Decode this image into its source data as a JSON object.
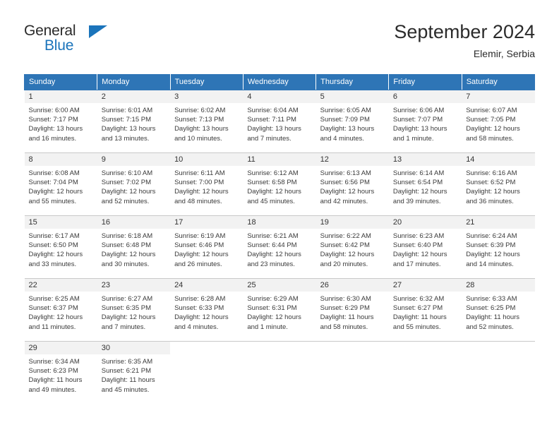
{
  "brand": {
    "name_top": "General",
    "name_bottom": "Blue",
    "triangle_icon": "triangle-icon",
    "accent_color": "#1b74bb"
  },
  "header": {
    "title": "September 2024",
    "subtitle": "Elemir, Serbia"
  },
  "theme": {
    "header_bg": "#2e75b6",
    "header_text": "#ffffff",
    "daynum_bg": "#f2f2f2",
    "cell_bg": "#ffffff",
    "rule_color": "#c9c9c9",
    "text_color": "#3a3a3a"
  },
  "calendar": {
    "weekday_headers": [
      "Sunday",
      "Monday",
      "Tuesday",
      "Wednesday",
      "Thursday",
      "Friday",
      "Saturday"
    ],
    "weeks": [
      [
        {
          "day": "1",
          "sunrise": "Sunrise: 6:00 AM",
          "sunset": "Sunset: 7:17 PM",
          "daylight_1": "Daylight: 13 hours",
          "daylight_2": "and 16 minutes."
        },
        {
          "day": "2",
          "sunrise": "Sunrise: 6:01 AM",
          "sunset": "Sunset: 7:15 PM",
          "daylight_1": "Daylight: 13 hours",
          "daylight_2": "and 13 minutes."
        },
        {
          "day": "3",
          "sunrise": "Sunrise: 6:02 AM",
          "sunset": "Sunset: 7:13 PM",
          "daylight_1": "Daylight: 13 hours",
          "daylight_2": "and 10 minutes."
        },
        {
          "day": "4",
          "sunrise": "Sunrise: 6:04 AM",
          "sunset": "Sunset: 7:11 PM",
          "daylight_1": "Daylight: 13 hours",
          "daylight_2": "and 7 minutes."
        },
        {
          "day": "5",
          "sunrise": "Sunrise: 6:05 AM",
          "sunset": "Sunset: 7:09 PM",
          "daylight_1": "Daylight: 13 hours",
          "daylight_2": "and 4 minutes."
        },
        {
          "day": "6",
          "sunrise": "Sunrise: 6:06 AM",
          "sunset": "Sunset: 7:07 PM",
          "daylight_1": "Daylight: 13 hours",
          "daylight_2": "and 1 minute."
        },
        {
          "day": "7",
          "sunrise": "Sunrise: 6:07 AM",
          "sunset": "Sunset: 7:05 PM",
          "daylight_1": "Daylight: 12 hours",
          "daylight_2": "and 58 minutes."
        }
      ],
      [
        {
          "day": "8",
          "sunrise": "Sunrise: 6:08 AM",
          "sunset": "Sunset: 7:04 PM",
          "daylight_1": "Daylight: 12 hours",
          "daylight_2": "and 55 minutes."
        },
        {
          "day": "9",
          "sunrise": "Sunrise: 6:10 AM",
          "sunset": "Sunset: 7:02 PM",
          "daylight_1": "Daylight: 12 hours",
          "daylight_2": "and 52 minutes."
        },
        {
          "day": "10",
          "sunrise": "Sunrise: 6:11 AM",
          "sunset": "Sunset: 7:00 PM",
          "daylight_1": "Daylight: 12 hours",
          "daylight_2": "and 48 minutes."
        },
        {
          "day": "11",
          "sunrise": "Sunrise: 6:12 AM",
          "sunset": "Sunset: 6:58 PM",
          "daylight_1": "Daylight: 12 hours",
          "daylight_2": "and 45 minutes."
        },
        {
          "day": "12",
          "sunrise": "Sunrise: 6:13 AM",
          "sunset": "Sunset: 6:56 PM",
          "daylight_1": "Daylight: 12 hours",
          "daylight_2": "and 42 minutes."
        },
        {
          "day": "13",
          "sunrise": "Sunrise: 6:14 AM",
          "sunset": "Sunset: 6:54 PM",
          "daylight_1": "Daylight: 12 hours",
          "daylight_2": "and 39 minutes."
        },
        {
          "day": "14",
          "sunrise": "Sunrise: 6:16 AM",
          "sunset": "Sunset: 6:52 PM",
          "daylight_1": "Daylight: 12 hours",
          "daylight_2": "and 36 minutes."
        }
      ],
      [
        {
          "day": "15",
          "sunrise": "Sunrise: 6:17 AM",
          "sunset": "Sunset: 6:50 PM",
          "daylight_1": "Daylight: 12 hours",
          "daylight_2": "and 33 minutes."
        },
        {
          "day": "16",
          "sunrise": "Sunrise: 6:18 AM",
          "sunset": "Sunset: 6:48 PM",
          "daylight_1": "Daylight: 12 hours",
          "daylight_2": "and 30 minutes."
        },
        {
          "day": "17",
          "sunrise": "Sunrise: 6:19 AM",
          "sunset": "Sunset: 6:46 PM",
          "daylight_1": "Daylight: 12 hours",
          "daylight_2": "and 26 minutes."
        },
        {
          "day": "18",
          "sunrise": "Sunrise: 6:21 AM",
          "sunset": "Sunset: 6:44 PM",
          "daylight_1": "Daylight: 12 hours",
          "daylight_2": "and 23 minutes."
        },
        {
          "day": "19",
          "sunrise": "Sunrise: 6:22 AM",
          "sunset": "Sunset: 6:42 PM",
          "daylight_1": "Daylight: 12 hours",
          "daylight_2": "and 20 minutes."
        },
        {
          "day": "20",
          "sunrise": "Sunrise: 6:23 AM",
          "sunset": "Sunset: 6:40 PM",
          "daylight_1": "Daylight: 12 hours",
          "daylight_2": "and 17 minutes."
        },
        {
          "day": "21",
          "sunrise": "Sunrise: 6:24 AM",
          "sunset": "Sunset: 6:39 PM",
          "daylight_1": "Daylight: 12 hours",
          "daylight_2": "and 14 minutes."
        }
      ],
      [
        {
          "day": "22",
          "sunrise": "Sunrise: 6:25 AM",
          "sunset": "Sunset: 6:37 PM",
          "daylight_1": "Daylight: 12 hours",
          "daylight_2": "and 11 minutes."
        },
        {
          "day": "23",
          "sunrise": "Sunrise: 6:27 AM",
          "sunset": "Sunset: 6:35 PM",
          "daylight_1": "Daylight: 12 hours",
          "daylight_2": "and 7 minutes."
        },
        {
          "day": "24",
          "sunrise": "Sunrise: 6:28 AM",
          "sunset": "Sunset: 6:33 PM",
          "daylight_1": "Daylight: 12 hours",
          "daylight_2": "and 4 minutes."
        },
        {
          "day": "25",
          "sunrise": "Sunrise: 6:29 AM",
          "sunset": "Sunset: 6:31 PM",
          "daylight_1": "Daylight: 12 hours",
          "daylight_2": "and 1 minute."
        },
        {
          "day": "26",
          "sunrise": "Sunrise: 6:30 AM",
          "sunset": "Sunset: 6:29 PM",
          "daylight_1": "Daylight: 11 hours",
          "daylight_2": "and 58 minutes."
        },
        {
          "day": "27",
          "sunrise": "Sunrise: 6:32 AM",
          "sunset": "Sunset: 6:27 PM",
          "daylight_1": "Daylight: 11 hours",
          "daylight_2": "and 55 minutes."
        },
        {
          "day": "28",
          "sunrise": "Sunrise: 6:33 AM",
          "sunset": "Sunset: 6:25 PM",
          "daylight_1": "Daylight: 11 hours",
          "daylight_2": "and 52 minutes."
        }
      ],
      [
        {
          "day": "29",
          "sunrise": "Sunrise: 6:34 AM",
          "sunset": "Sunset: 6:23 PM",
          "daylight_1": "Daylight: 11 hours",
          "daylight_2": "and 49 minutes."
        },
        {
          "day": "30",
          "sunrise": "Sunrise: 6:35 AM",
          "sunset": "Sunset: 6:21 PM",
          "daylight_1": "Daylight: 11 hours",
          "daylight_2": "and 45 minutes."
        },
        {
          "day": "",
          "sunrise": "",
          "sunset": "",
          "daylight_1": "",
          "daylight_2": ""
        },
        {
          "day": "",
          "sunrise": "",
          "sunset": "",
          "daylight_1": "",
          "daylight_2": ""
        },
        {
          "day": "",
          "sunrise": "",
          "sunset": "",
          "daylight_1": "",
          "daylight_2": ""
        },
        {
          "day": "",
          "sunrise": "",
          "sunset": "",
          "daylight_1": "",
          "daylight_2": ""
        },
        {
          "day": "",
          "sunrise": "",
          "sunset": "",
          "daylight_1": "",
          "daylight_2": ""
        }
      ]
    ]
  }
}
